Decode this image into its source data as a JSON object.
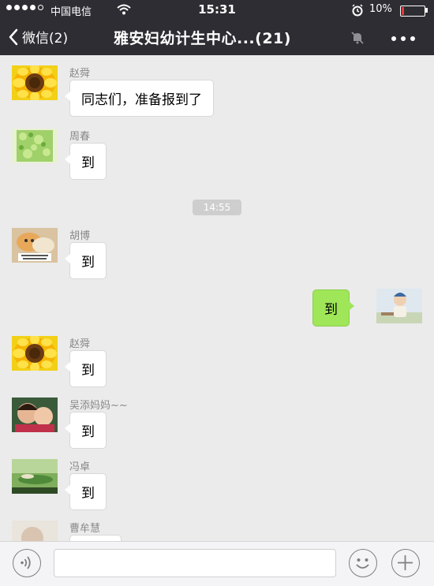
{
  "status_bar": {
    "carrier": "中国电信",
    "time": "15:31",
    "battery": "10%",
    "battery_level": 0.1,
    "battery_color": "#e23b3b",
    "icons": [
      "signal-dots",
      "wifi-icon",
      "alarm-icon",
      "battery-icon"
    ]
  },
  "nav": {
    "back_label": "微信(2)",
    "title": "雅安妇幼计生中心...(21)",
    "icons": [
      "chevron-left-icon",
      "mute-bell-icon",
      "more-icon"
    ]
  },
  "messages": [
    {
      "sender": "赵舜",
      "text": "同志们，准备报到了",
      "direction": "received",
      "avatar": "sunflower"
    },
    {
      "sender": "周春",
      "text": "到",
      "direction": "received",
      "avatar": "green-field"
    },
    {
      "time_divider": "14:55"
    },
    {
      "sender": "胡博",
      "text": "到",
      "direction": "received",
      "avatar": "kitten"
    },
    {
      "text": "到",
      "direction": "sent",
      "avatar": "baby"
    },
    {
      "sender": "赵舜",
      "text": "到",
      "direction": "received",
      "avatar": "sunflower"
    },
    {
      "sender": "吴添妈妈~~",
      "text": "到",
      "direction": "received",
      "avatar": "mother-child"
    },
    {
      "sender": "冯卓",
      "text": "到",
      "direction": "received",
      "avatar": "landscape"
    },
    {
      "sender": "曹牟慧",
      "text": "",
      "direction": "received",
      "avatar": "portrait"
    }
  ],
  "colors": {
    "bar_background": "#2e2d33",
    "chat_background": "#ebebeb",
    "sent_bubble": "#9fe658",
    "received_bubble": "#ffffff"
  },
  "input_bar": {
    "placeholder": "",
    "icons": [
      "voice-icon",
      "emoji-icon",
      "plus-icon"
    ]
  }
}
